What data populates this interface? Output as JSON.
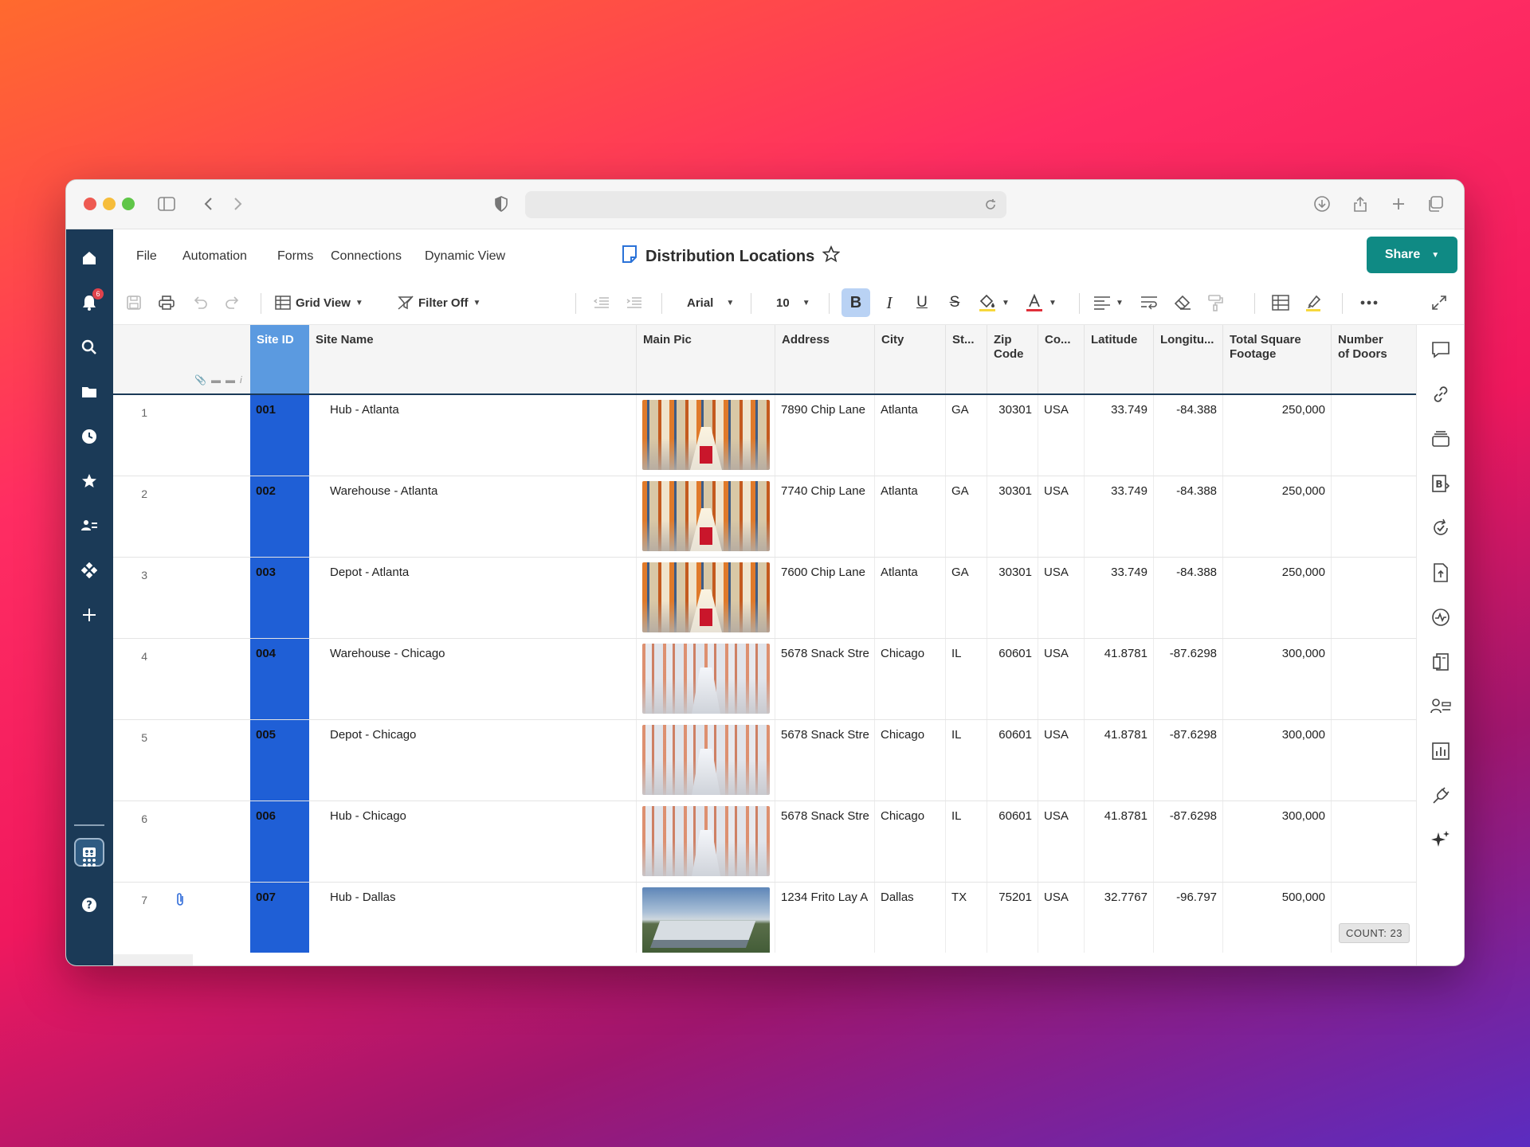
{
  "app": {
    "menu": [
      "File",
      "Automation",
      "Forms",
      "Connections",
      "Dynamic View"
    ],
    "title": "Distribution Locations",
    "share_label": "Share",
    "notification_count": "6"
  },
  "toolbar": {
    "view_label": "Grid View",
    "filter_label": "Filter Off",
    "font_name": "Arial",
    "font_size": "10",
    "bold_label": "B",
    "italic_label": "I",
    "underline_label": "U",
    "strike_label": "S"
  },
  "grid": {
    "columns": [
      "Site ID",
      "Site Name",
      "Main Pic",
      "Address",
      "City",
      "St...",
      "Zip Code",
      "Co...",
      "Latitude",
      "Longitu...",
      "Total Square Footage",
      "Number of Doors"
    ],
    "rows": [
      {
        "num": "1",
        "id": "001",
        "name": "Hub - Atlanta",
        "pic": "warehouse",
        "address": "7890 Chip Lane",
        "city": "Atlanta",
        "state": "GA",
        "zip": "30301",
        "country": "USA",
        "lat": "33.749",
        "lon": "-84.388",
        "sqft": "250,000",
        "attach": false
      },
      {
        "num": "2",
        "id": "002",
        "name": "Warehouse - Atlanta",
        "pic": "warehouse",
        "address": "7740 Chip Lane",
        "city": "Atlanta",
        "state": "GA",
        "zip": "30301",
        "country": "USA",
        "lat": "33.749",
        "lon": "-84.388",
        "sqft": "250,000",
        "attach": false
      },
      {
        "num": "3",
        "id": "003",
        "name": "Depot - Atlanta",
        "pic": "warehouse",
        "address": "7600 Chip Lane",
        "city": "Atlanta",
        "state": "GA",
        "zip": "30301",
        "country": "USA",
        "lat": "33.749",
        "lon": "-84.388",
        "sqft": "250,000",
        "attach": false
      },
      {
        "num": "4",
        "id": "004",
        "name": "Warehouse - Chicago",
        "pic": "bright",
        "address": "5678 Snack Stre",
        "city": "Chicago",
        "state": "IL",
        "zip": "60601",
        "country": "USA",
        "lat": "41.8781",
        "lon": "-87.6298",
        "sqft": "300,000",
        "attach": false
      },
      {
        "num": "5",
        "id": "005",
        "name": "Depot - Chicago",
        "pic": "bright",
        "address": "5678 Snack Stre",
        "city": "Chicago",
        "state": "IL",
        "zip": "60601",
        "country": "USA",
        "lat": "41.8781",
        "lon": "-87.6298",
        "sqft": "300,000",
        "attach": false
      },
      {
        "num": "6",
        "id": "006",
        "name": "Hub - Chicago",
        "pic": "bright",
        "address": "5678 Snack Stre",
        "city": "Chicago",
        "state": "IL",
        "zip": "60601",
        "country": "USA",
        "lat": "41.8781",
        "lon": "-87.6298",
        "sqft": "300,000",
        "attach": false
      },
      {
        "num": "7",
        "id": "007",
        "name": "Hub - Dallas",
        "pic": "aerial",
        "address": "1234 Frito Lay A",
        "city": "Dallas",
        "state": "TX",
        "zip": "75201",
        "country": "USA",
        "lat": "32.7767",
        "lon": "-96.797",
        "sqft": "500,000",
        "attach": true
      }
    ],
    "count_label": "COUNT:",
    "count_value": "23"
  },
  "colors": {
    "nav_bg": "#1b3a57",
    "share_bg": "#0f8a84",
    "primary_col": "#1f5fd6",
    "primary_header": "#5b9ae0"
  }
}
